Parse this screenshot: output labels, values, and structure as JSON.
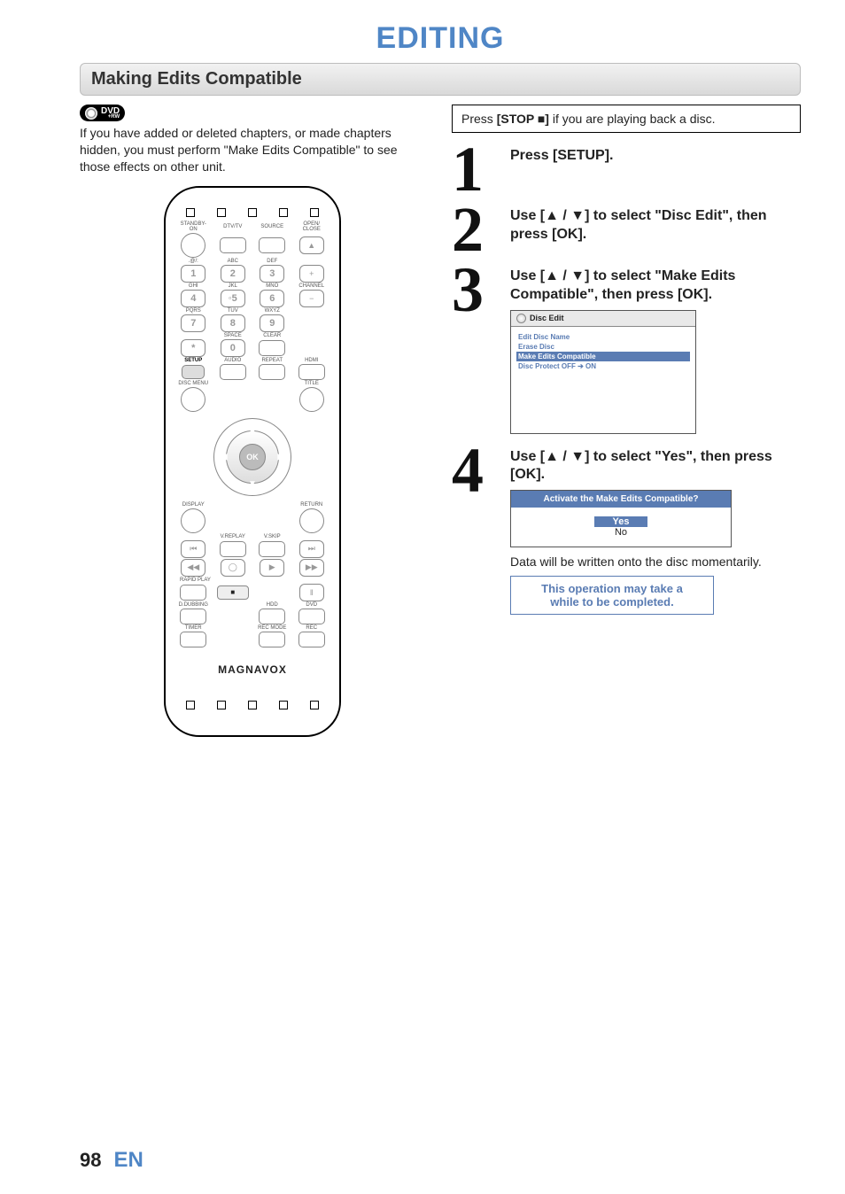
{
  "page_title": "EDITING",
  "section_title": "Making Edits Compatible",
  "dvd_badge": {
    "main": "DVD",
    "sub": "+RW"
  },
  "intro_text": "If you have added or deleted chapters, or made chapters hidden, you must perform \"Make Edits Compatible\" to see those effects on other unit.",
  "top_callout_prefix": "Press ",
  "top_callout_button": "[STOP ■]",
  "top_callout_suffix": " if you are playing back a disc.",
  "steps": [
    {
      "num": "1",
      "title": "Press [SETUP]."
    },
    {
      "num": "2",
      "title": "Use [▲ / ▼] to select \"Disc Edit\", then press [OK]."
    },
    {
      "num": "3",
      "title": "Use [▲ / ▼] to select \"Make Edits Compatible\", then press [OK]."
    },
    {
      "num": "4",
      "title": "Use [▲ / ▼] to select \"Yes\", then press [OK]."
    }
  ],
  "disc_edit_menu": {
    "header": "Disc Edit",
    "items": [
      "Edit Disc Name",
      "Erase Disc",
      "Make Edits Compatible",
      "Disc Protect OFF ➔ ON"
    ],
    "selected_index": 2
  },
  "dialog": {
    "title": "Activate the Make Edits Compatible?",
    "options": [
      "Yes",
      "No"
    ],
    "selected_index": 0
  },
  "after_dialog_text": "Data will be written onto the disc momentarily.",
  "note_box_line1": "This operation may take a",
  "note_box_line2": "while to be completed.",
  "remote": {
    "row1_labels": [
      "STANDBY-ON",
      "DTV/TV",
      "SOURCE",
      "OPEN/\nCLOSE"
    ],
    "num_rows": [
      {
        "above": [
          ".@/:",
          "ABC",
          "DEF"
        ],
        "keys": [
          "1",
          "2",
          "3"
        ],
        "side": "+"
      },
      {
        "above": [
          "GHI",
          "JKL",
          "MNO"
        ],
        "keys": [
          "4",
          "5",
          "6"
        ],
        "side": "−",
        "sidelabel": "CHANNEL"
      },
      {
        "above": [
          "PQRS",
          "TUV",
          "WXYZ"
        ],
        "keys": [
          "7",
          "8",
          "9"
        ],
        "side": ""
      },
      {
        "above": [
          "",
          "SPACE",
          "CLEAR"
        ],
        "keys": [
          "*",
          "0",
          ""
        ],
        "side": ""
      }
    ],
    "row_setup": [
      "SETUP",
      "AUDIO",
      "REPEAT",
      "HDMI"
    ],
    "row_menu": [
      "DISC MENU",
      "",
      "",
      "TITLE"
    ],
    "ok": "OK",
    "row_disp": [
      "DISPLAY",
      "",
      "",
      "RETURN"
    ],
    "row_vr": [
      "",
      "V.REPLAY",
      "V.SKIP",
      ""
    ],
    "row_trans1": [
      "⏮",
      "",
      "",
      "⏭"
    ],
    "row_trans2": [
      "◀◀",
      "◯",
      "▶",
      "▶▶"
    ],
    "rapid": "RAPID PLAY",
    "row_stop": [
      "",
      "■",
      "",
      "‖"
    ],
    "row_dub": [
      "D.DUBBING",
      "",
      "HDD",
      "DVD"
    ],
    "row_timer": [
      "TIMER",
      "",
      "REC MODE",
      "REC"
    ],
    "brand": "MAGNAVOX"
  },
  "footer": {
    "page": "98",
    "lang": "EN"
  }
}
